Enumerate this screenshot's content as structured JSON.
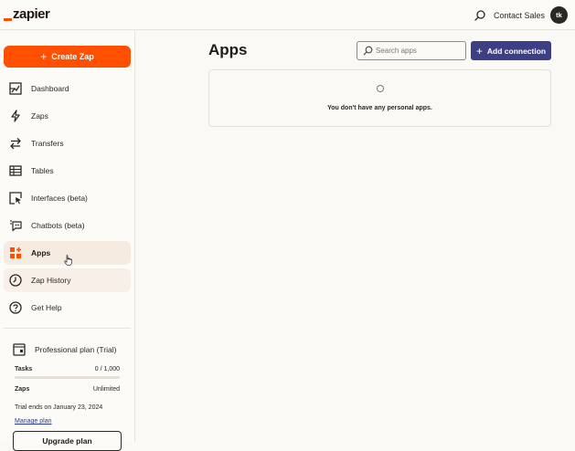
{
  "header": {
    "logo_text": "zapier",
    "contact_label": "Contact Sales",
    "avatar_initials": "tk"
  },
  "sidebar": {
    "create_label": "Create Zap",
    "items": [
      {
        "label": "Dashboard",
        "icon": "dashboard-icon"
      },
      {
        "label": "Zaps",
        "icon": "lightning-icon"
      },
      {
        "label": "Transfers",
        "icon": "transfer-arrows-icon"
      },
      {
        "label": "Tables",
        "icon": "table-icon"
      },
      {
        "label": "Interfaces (beta)",
        "icon": "interface-cursor-icon"
      },
      {
        "label": "Chatbots (beta)",
        "icon": "chatbot-icon"
      },
      {
        "label": "Apps",
        "icon": "apps-grid-icon",
        "active": true
      },
      {
        "label": "Zap History",
        "icon": "history-clock-icon"
      },
      {
        "label": "Get Help",
        "icon": "help-icon"
      }
    ],
    "plan": {
      "title": "Professional plan (Trial)",
      "tasks_label": "Tasks",
      "tasks_value": "0 / 1,000",
      "tasks_used_fraction": 0,
      "zaps_label": "Zaps",
      "zaps_value": "Unlimited",
      "trial_text": "Trial ends on January 23, 2024",
      "manage_label": "Manage plan",
      "upgrade_label": "Upgrade plan"
    }
  },
  "main": {
    "title": "Apps",
    "search_placeholder": "Search apps",
    "add_connection_label": "Add connection",
    "empty_message": "You don't have any personal apps."
  },
  "colors": {
    "brand_orange": "#ff4f00",
    "primary_button": "#3d3f86",
    "active_nav_bg": "#f6ebe1",
    "page_bg": "#fbf9f5"
  }
}
